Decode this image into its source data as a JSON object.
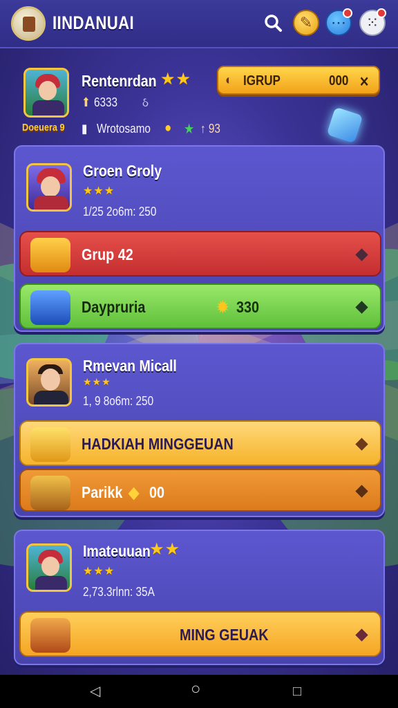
{
  "topbar": {
    "title": "IINDANUAI"
  },
  "profile": {
    "name": "Rentenrdan",
    "stat": "6333",
    "stat_suffix": "ઠ",
    "badge": "Doeuera 9",
    "sub_label": "Wrotosamo",
    "sub_value": "↑ 93",
    "grup_label": "IGRUP",
    "grup_value": "000",
    "grup_close": "✕"
  },
  "cards": [
    {
      "name": "Groen Groly",
      "stars": "★★★",
      "meta": "1/25 2o6m: 250",
      "bars": [
        {
          "label": "Grup 42",
          "value": ""
        },
        {
          "label": "Daypruria",
          "value": "330"
        }
      ]
    },
    {
      "name": "Rmevan Micall",
      "stars": "★★★",
      "meta": "1, 9 8o6m: 250",
      "bars": [
        {
          "label": "HADKIAH MINGGEUAN",
          "value": ""
        },
        {
          "label": "Parikk",
          "value": "00"
        }
      ]
    },
    {
      "name": "Imateuuan",
      "stars": "★★★",
      "meta": "2,73.3rlnn: 35A",
      "bars": [
        {
          "label": "MING GEUAK",
          "value": ""
        }
      ]
    }
  ],
  "colors": {
    "red_bar": "#d63b3b",
    "green_bar": "#7ad04e",
    "gold_bar": "#f6b52a",
    "orange_bar": "#e9892a"
  },
  "nav": {
    "back": "◁",
    "home": "○",
    "recent": "□"
  }
}
